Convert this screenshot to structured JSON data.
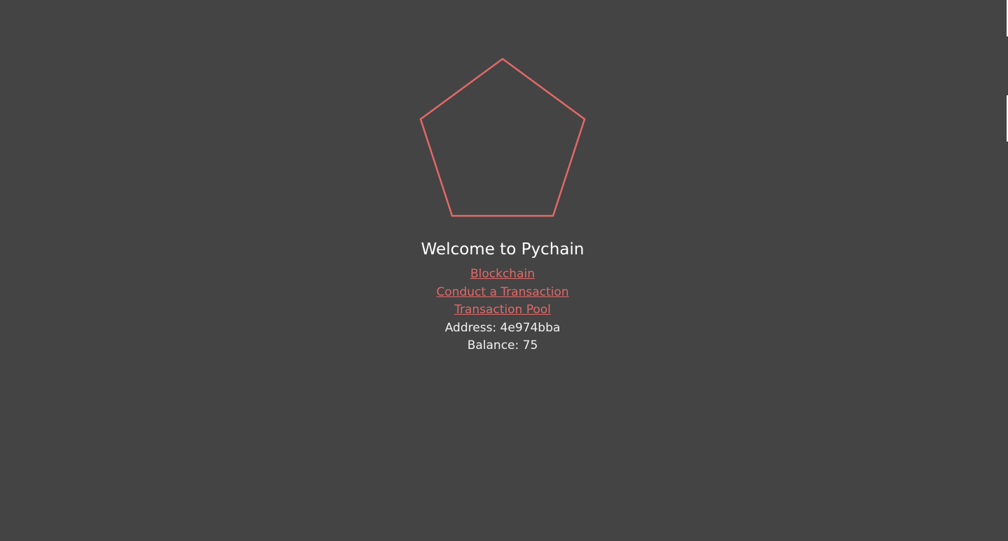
{
  "page": {
    "title": "Welcome to Pychain",
    "logo_icon": "pentagon-icon",
    "accent_color": "#e36868",
    "background_color": "#444444"
  },
  "nav": {
    "links": [
      {
        "label": "Blockchain"
      },
      {
        "label": "Conduct a Transaction"
      },
      {
        "label": "Transaction Pool"
      }
    ]
  },
  "wallet": {
    "address": "Address: 4e974bba",
    "balance": "Balance: 75"
  }
}
